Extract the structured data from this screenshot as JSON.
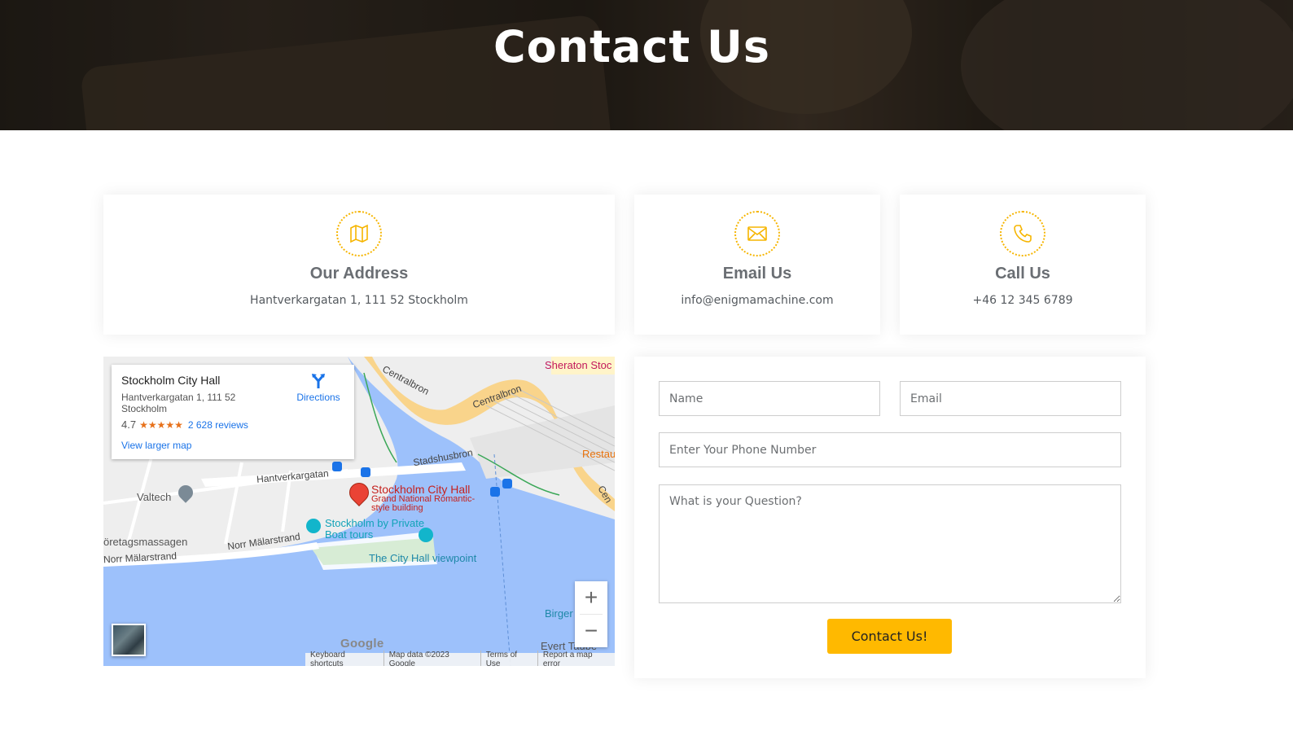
{
  "hero": {
    "title": "Contact Us"
  },
  "cards": [
    {
      "icon": "map-icon",
      "title": "Our Address",
      "text": "Hantverkargatan 1, 111 52 Stockholm"
    },
    {
      "icon": "envelope-icon",
      "title": "Email Us",
      "text": "info@enigmamachine.com"
    },
    {
      "icon": "phone-icon",
      "title": "Call Us",
      "text": "+46 12 345 6789"
    }
  ],
  "map": {
    "place_name": "Stockholm City Hall",
    "address": "Hantverkargatan 1, 111 52 Stockholm",
    "rating": "4.7",
    "stars": "★★★★★",
    "reviews": "2 628 reviews",
    "view_larger": "View larger map",
    "directions": "Directions",
    "marker_title": "Stockholm City Hall",
    "marker_sub": "Grand National Romantic-style building",
    "labels": {
      "sheraton": "Sheraton Stoc",
      "centralbron_a": "Centralbron",
      "centralbron_b": "Centralbron",
      "restau": "Restau",
      "cen": "Cen",
      "stadshusbron": "Stadshusbron",
      "hantverkargatan": "Hantverkargatan",
      "valtech": "Valtech",
      "boat_tours": "Stockholm by Private Boat tours",
      "viewpoint": "The City Hall viewpoint",
      "foretags": "öretagsmassagen",
      "norr_malarstrand_a": "Norr Mälarstrand",
      "norr_malarstrand_b": "Norr Mälarstrand",
      "birger": "Birger",
      "evert": "Evert Taube",
      "google": "Google"
    },
    "zoom_in": "+",
    "zoom_out": "−",
    "attribution": [
      "Keyboard shortcuts",
      "Map data ©2023 Google",
      "Terms of Use",
      "Report a map error"
    ]
  },
  "form": {
    "name_placeholder": "Name",
    "email_placeholder": "Email",
    "phone_placeholder": "Enter Your Phone Number",
    "question_placeholder": "What is your Question?",
    "submit_label": "Contact Us!"
  },
  "colors": {
    "accent": "#ffb900",
    "icon_ring": "#f6b500",
    "heading": "#6a6e73",
    "link": "#1a73e8",
    "water": "#9dc1fb",
    "road": "#f9d48b"
  }
}
